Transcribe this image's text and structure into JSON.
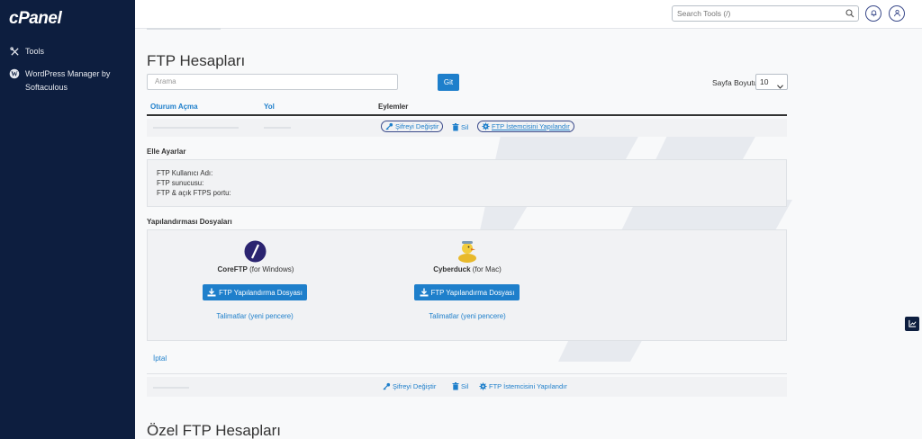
{
  "sidebar": {
    "logo": "cPanel",
    "items": [
      {
        "label": "Tools",
        "icon": "tools-icon"
      },
      {
        "label": "WordPress Manager by Softaculous",
        "icon": "wordpress-icon"
      }
    ]
  },
  "topbar": {
    "search_placeholder": "Search Tools (/)"
  },
  "main": {
    "title": "FTP Hesapları",
    "filter_placeholder": "Arama",
    "go_label": "Git",
    "page_size_label": "Sayfa Boyutu",
    "page_size_value": "10",
    "columns": [
      "Oturum Açma",
      "Yol",
      "Eylemler"
    ],
    "actions": {
      "change_password": "Şifreyi Değiştir",
      "delete": "Sil",
      "configure_client": "FTP İstemcisini Yapılandır"
    },
    "manual_settings": {
      "heading": "Elle Ayarlar",
      "lines": [
        "FTP Kullanıcı Adı:",
        "FTP sunucusu:",
        "FTP & açık FTPS portu:"
      ]
    },
    "config_files": {
      "heading": "Yapılandırması Dosyaları",
      "clients": [
        {
          "name": "CoreFTP",
          "platform": "(for Windows)",
          "button": "FTP Yapılandırma Dosyası",
          "instructions": "Talimatlar (yeni pencere)"
        },
        {
          "name": "Cyberduck",
          "platform": "(for Mac)",
          "button": "FTP Yapılandırma Dosyası",
          "instructions": "Talimatlar (yeni pencere)"
        }
      ]
    },
    "cancel_label": "İptal",
    "special_title": "Özel FTP Hesapları"
  },
  "colors": {
    "sidebar_bg": "#0d1e3f",
    "accent": "#1e7fcb"
  }
}
